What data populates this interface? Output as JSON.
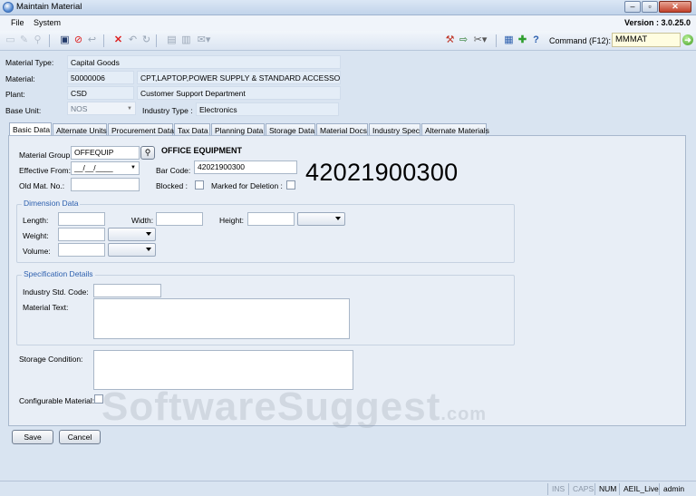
{
  "window": {
    "title": "Maintain Material"
  },
  "menu": {
    "items": [
      "File",
      "System"
    ],
    "version": "Version : 3.0.25.0"
  },
  "toolbar": {
    "command_label": "Command (F12):",
    "command_value": "MMMAT"
  },
  "header": {
    "material_type_label": "Material Type:",
    "material_type_value": "Capital Goods",
    "material_label": "Material:",
    "material_code": "50000006",
    "material_desc": "CPT,LAPTOP,POWER SUPPLY & STANDARD ACCESSORIE",
    "plant_label": "Plant:",
    "plant_code": "CSD",
    "plant_desc": "Customer Support Department",
    "base_unit_label": "Base Unit:",
    "base_unit_value": "NOS",
    "industry_type_label": "Industry Type :",
    "industry_type_value": "Electronics"
  },
  "tabs": [
    "Basic Data",
    "Alternate Units",
    "Procurement Data",
    "Tax Data",
    "Planning Data",
    "Storage Data",
    "Material Docs",
    "Industry Spec",
    "Alternate Materials"
  ],
  "basic": {
    "material_group_label": "Material Group:",
    "material_group_value": "OFFEQUIP",
    "material_group_desc": "OFFICE EQUIPMENT",
    "effective_from_label": "Effective From:",
    "effective_from_value": "__/__/____",
    "bar_code_label": "Bar Code:",
    "bar_code_value": "42021900300",
    "bar_code_big": "42021900300",
    "old_mat_label": "Old Mat. No.:",
    "blocked_label": "Blocked :",
    "marked_deletion_label": "Marked for Deletion :"
  },
  "dimension": {
    "title": "Dimension Data",
    "length_label": "Length:",
    "width_label": "Width:",
    "height_label": "Height:",
    "weight_label": "Weight:",
    "volume_label": "Volume:"
  },
  "spec": {
    "title": "Specification Details",
    "industry_std_label": "Industry Std. Code:",
    "material_text_label": "Material Text:"
  },
  "storage_condition_label": "Storage Condition:",
  "configurable_label": "Configurable Material:",
  "buttons": {
    "save": "Save",
    "cancel": "Cancel"
  },
  "status": [
    "INS",
    "CAPS",
    "NUM",
    "AEIL_Live",
    "admin"
  ],
  "watermark": {
    "main": "SoftwareSuggest",
    "suffix": ".com"
  }
}
